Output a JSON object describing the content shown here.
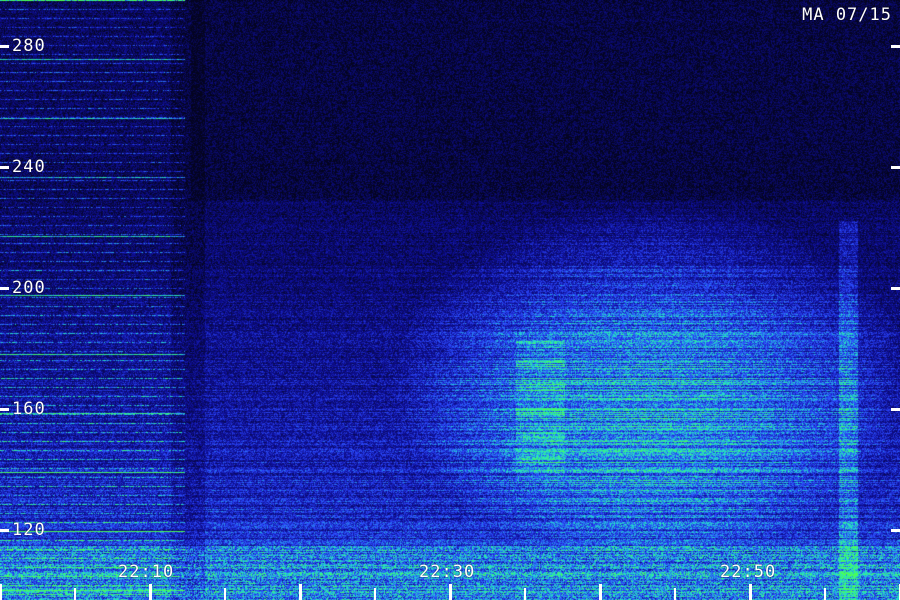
{
  "title": "MA 07/15",
  "y_axis": {
    "labels": [
      "280",
      "240",
      "200",
      "160",
      "120"
    ],
    "values": [
      280,
      240,
      200,
      160,
      120
    ],
    "range": [
      105,
      300
    ]
  },
  "x_axis": {
    "labels": [
      "22:10",
      "22:30",
      "22:50"
    ],
    "range_minutes": [
      0,
      58
    ]
  },
  "colors": {
    "background": "#03031a",
    "low": "#0a0a6e",
    "mid": "#2a4aff",
    "high": "#30d8d0",
    "peak": "#40ff60",
    "text": "#ffffff"
  }
}
